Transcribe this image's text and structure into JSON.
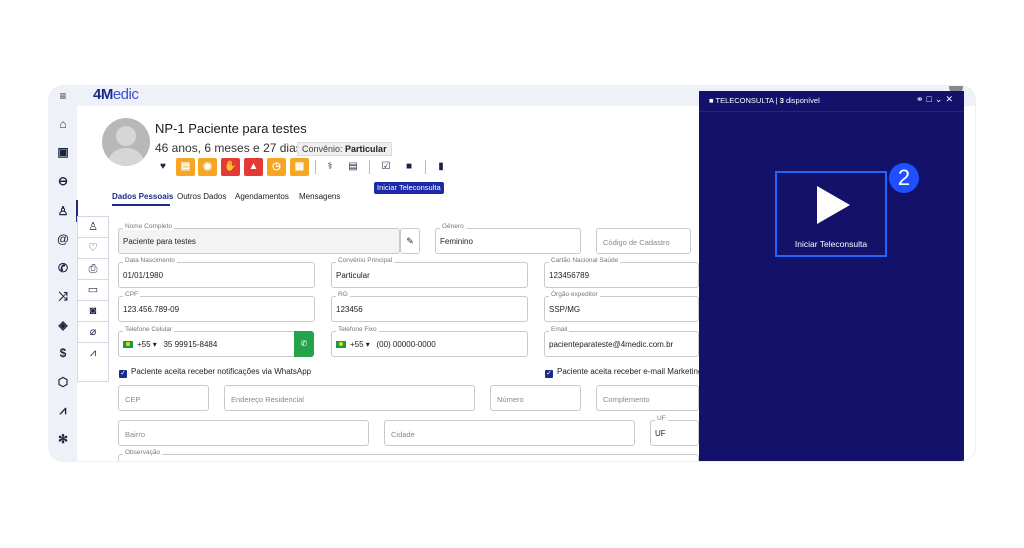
{
  "app": {
    "logo_main": "4M",
    "logo_rest": "edic"
  },
  "leftbar": {
    "icons": [
      "menu-icon",
      "home-icon",
      "calendar-icon",
      "car-icon",
      "user-icon",
      "at-icon",
      "phone-icon",
      "shuffle-icon",
      "tag-icon",
      "dollar-icon",
      "box-icon",
      "chart-icon",
      "gear-icon"
    ]
  },
  "patient": {
    "name": "NP-1 Paciente para testes",
    "age": "46 anos, 6 meses e 27 dias",
    "convenio_label": "Convênio:",
    "convenio_value": "Particular"
  },
  "toolbar": {
    "badges": [
      {
        "icon": "clipboard-icon",
        "color": "#f5a623"
      },
      {
        "icon": "pill-icon",
        "color": "#f5a623"
      },
      {
        "icon": "hand-stop-icon",
        "color": "#e53935"
      },
      {
        "icon": "warning-icon",
        "color": "#e53935"
      },
      {
        "icon": "clock-icon",
        "color": "#f5a623"
      },
      {
        "icon": "grid-icon",
        "color": "#f5a623"
      }
    ],
    "tooltip": "Iniciar Teleconsulta"
  },
  "tabs": [
    "Dados Pessoais",
    "Outros Dados",
    "Agendamentos",
    "Mensagens"
  ],
  "form": {
    "nome": {
      "label": "Nome Completo",
      "value": "Paciente para testes"
    },
    "genero": {
      "label": "Gênero",
      "value": "Feminino"
    },
    "codigo": {
      "placeholder": "Código de Cadastro"
    },
    "nascimento": {
      "label": "Data Nascimento",
      "value": "01/01/1980"
    },
    "convenio": {
      "label": "Convênio Principal",
      "value": "Particular"
    },
    "cartao": {
      "label": "Cartão Nacional Saúde",
      "value": "123456789"
    },
    "cpf": {
      "label": "CPF",
      "value": "123.456.789-09"
    },
    "rg": {
      "label": "RG",
      "value": "123456"
    },
    "orgao": {
      "label": "Órgão expeditor",
      "value": "SSP/MG"
    },
    "celular": {
      "label": "Telefone Celular",
      "ddi": "+55 ▾",
      "value": "35 99915-8484"
    },
    "fixo": {
      "label": "Telefone Fixo",
      "ddi": "+55 ▾",
      "value": "(00) 00000-0000"
    },
    "email": {
      "label": "Email",
      "value": "pacienteparateste@4medic.com.br"
    },
    "whatsapp_check": "Paciente aceita receber notificações via WhatsApp",
    "email_check": "Paciente aceita receber e-mail Marketing",
    "cep": {
      "placeholder": "CEP"
    },
    "endereco": {
      "placeholder": "Endereço Residencial"
    },
    "numero": {
      "placeholder": "Número"
    },
    "complemento": {
      "placeholder": "Complemento"
    },
    "bairro": {
      "placeholder": "Bairro"
    },
    "cidade": {
      "placeholder": "Cidade"
    },
    "uf": {
      "label": "UF",
      "value": "UF"
    },
    "observacao": {
      "label": "Observação"
    }
  },
  "teleconsulta": {
    "title": "TELECONSULTA",
    "separator": "|",
    "count": "3",
    "status": "disponível",
    "start_label": "Iniciar Teleconsulta",
    "step_number": "2",
    "colors": {
      "panel_bg": "#13116a",
      "highlight": "#1f66ff"
    }
  }
}
